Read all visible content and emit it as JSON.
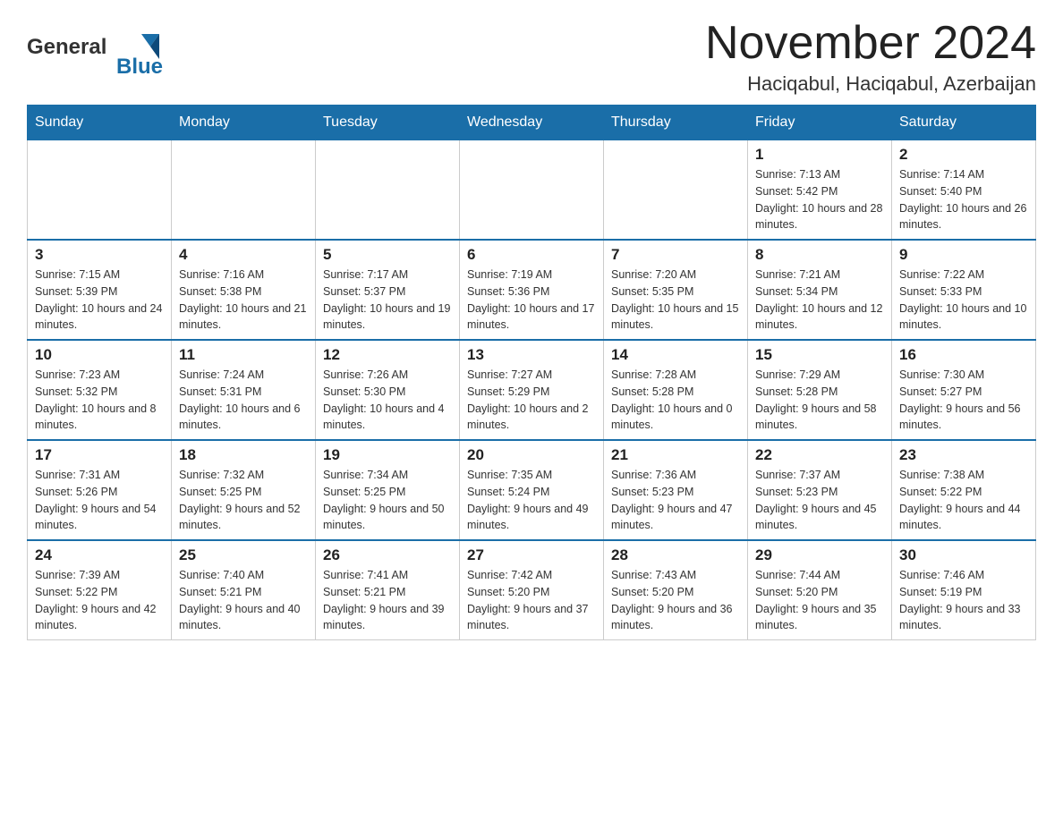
{
  "header": {
    "logo_general": "General",
    "logo_blue": "Blue",
    "month_title": "November 2024",
    "location": "Haciqabul, Haciqabul, Azerbaijan"
  },
  "days_of_week": [
    "Sunday",
    "Monday",
    "Tuesday",
    "Wednesday",
    "Thursday",
    "Friday",
    "Saturday"
  ],
  "weeks": [
    [
      {
        "day": "",
        "info": ""
      },
      {
        "day": "",
        "info": ""
      },
      {
        "day": "",
        "info": ""
      },
      {
        "day": "",
        "info": ""
      },
      {
        "day": "",
        "info": ""
      },
      {
        "day": "1",
        "info": "Sunrise: 7:13 AM\nSunset: 5:42 PM\nDaylight: 10 hours and 28 minutes."
      },
      {
        "day": "2",
        "info": "Sunrise: 7:14 AM\nSunset: 5:40 PM\nDaylight: 10 hours and 26 minutes."
      }
    ],
    [
      {
        "day": "3",
        "info": "Sunrise: 7:15 AM\nSunset: 5:39 PM\nDaylight: 10 hours and 24 minutes."
      },
      {
        "day": "4",
        "info": "Sunrise: 7:16 AM\nSunset: 5:38 PM\nDaylight: 10 hours and 21 minutes."
      },
      {
        "day": "5",
        "info": "Sunrise: 7:17 AM\nSunset: 5:37 PM\nDaylight: 10 hours and 19 minutes."
      },
      {
        "day": "6",
        "info": "Sunrise: 7:19 AM\nSunset: 5:36 PM\nDaylight: 10 hours and 17 minutes."
      },
      {
        "day": "7",
        "info": "Sunrise: 7:20 AM\nSunset: 5:35 PM\nDaylight: 10 hours and 15 minutes."
      },
      {
        "day": "8",
        "info": "Sunrise: 7:21 AM\nSunset: 5:34 PM\nDaylight: 10 hours and 12 minutes."
      },
      {
        "day": "9",
        "info": "Sunrise: 7:22 AM\nSunset: 5:33 PM\nDaylight: 10 hours and 10 minutes."
      }
    ],
    [
      {
        "day": "10",
        "info": "Sunrise: 7:23 AM\nSunset: 5:32 PM\nDaylight: 10 hours and 8 minutes."
      },
      {
        "day": "11",
        "info": "Sunrise: 7:24 AM\nSunset: 5:31 PM\nDaylight: 10 hours and 6 minutes."
      },
      {
        "day": "12",
        "info": "Sunrise: 7:26 AM\nSunset: 5:30 PM\nDaylight: 10 hours and 4 minutes."
      },
      {
        "day": "13",
        "info": "Sunrise: 7:27 AM\nSunset: 5:29 PM\nDaylight: 10 hours and 2 minutes."
      },
      {
        "day": "14",
        "info": "Sunrise: 7:28 AM\nSunset: 5:28 PM\nDaylight: 10 hours and 0 minutes."
      },
      {
        "day": "15",
        "info": "Sunrise: 7:29 AM\nSunset: 5:28 PM\nDaylight: 9 hours and 58 minutes."
      },
      {
        "day": "16",
        "info": "Sunrise: 7:30 AM\nSunset: 5:27 PM\nDaylight: 9 hours and 56 minutes."
      }
    ],
    [
      {
        "day": "17",
        "info": "Sunrise: 7:31 AM\nSunset: 5:26 PM\nDaylight: 9 hours and 54 minutes."
      },
      {
        "day": "18",
        "info": "Sunrise: 7:32 AM\nSunset: 5:25 PM\nDaylight: 9 hours and 52 minutes."
      },
      {
        "day": "19",
        "info": "Sunrise: 7:34 AM\nSunset: 5:25 PM\nDaylight: 9 hours and 50 minutes."
      },
      {
        "day": "20",
        "info": "Sunrise: 7:35 AM\nSunset: 5:24 PM\nDaylight: 9 hours and 49 minutes."
      },
      {
        "day": "21",
        "info": "Sunrise: 7:36 AM\nSunset: 5:23 PM\nDaylight: 9 hours and 47 minutes."
      },
      {
        "day": "22",
        "info": "Sunrise: 7:37 AM\nSunset: 5:23 PM\nDaylight: 9 hours and 45 minutes."
      },
      {
        "day": "23",
        "info": "Sunrise: 7:38 AM\nSunset: 5:22 PM\nDaylight: 9 hours and 44 minutes."
      }
    ],
    [
      {
        "day": "24",
        "info": "Sunrise: 7:39 AM\nSunset: 5:22 PM\nDaylight: 9 hours and 42 minutes."
      },
      {
        "day": "25",
        "info": "Sunrise: 7:40 AM\nSunset: 5:21 PM\nDaylight: 9 hours and 40 minutes."
      },
      {
        "day": "26",
        "info": "Sunrise: 7:41 AM\nSunset: 5:21 PM\nDaylight: 9 hours and 39 minutes."
      },
      {
        "day": "27",
        "info": "Sunrise: 7:42 AM\nSunset: 5:20 PM\nDaylight: 9 hours and 37 minutes."
      },
      {
        "day": "28",
        "info": "Sunrise: 7:43 AM\nSunset: 5:20 PM\nDaylight: 9 hours and 36 minutes."
      },
      {
        "day": "29",
        "info": "Sunrise: 7:44 AM\nSunset: 5:20 PM\nDaylight: 9 hours and 35 minutes."
      },
      {
        "day": "30",
        "info": "Sunrise: 7:46 AM\nSunset: 5:19 PM\nDaylight: 9 hours and 33 minutes."
      }
    ]
  ]
}
